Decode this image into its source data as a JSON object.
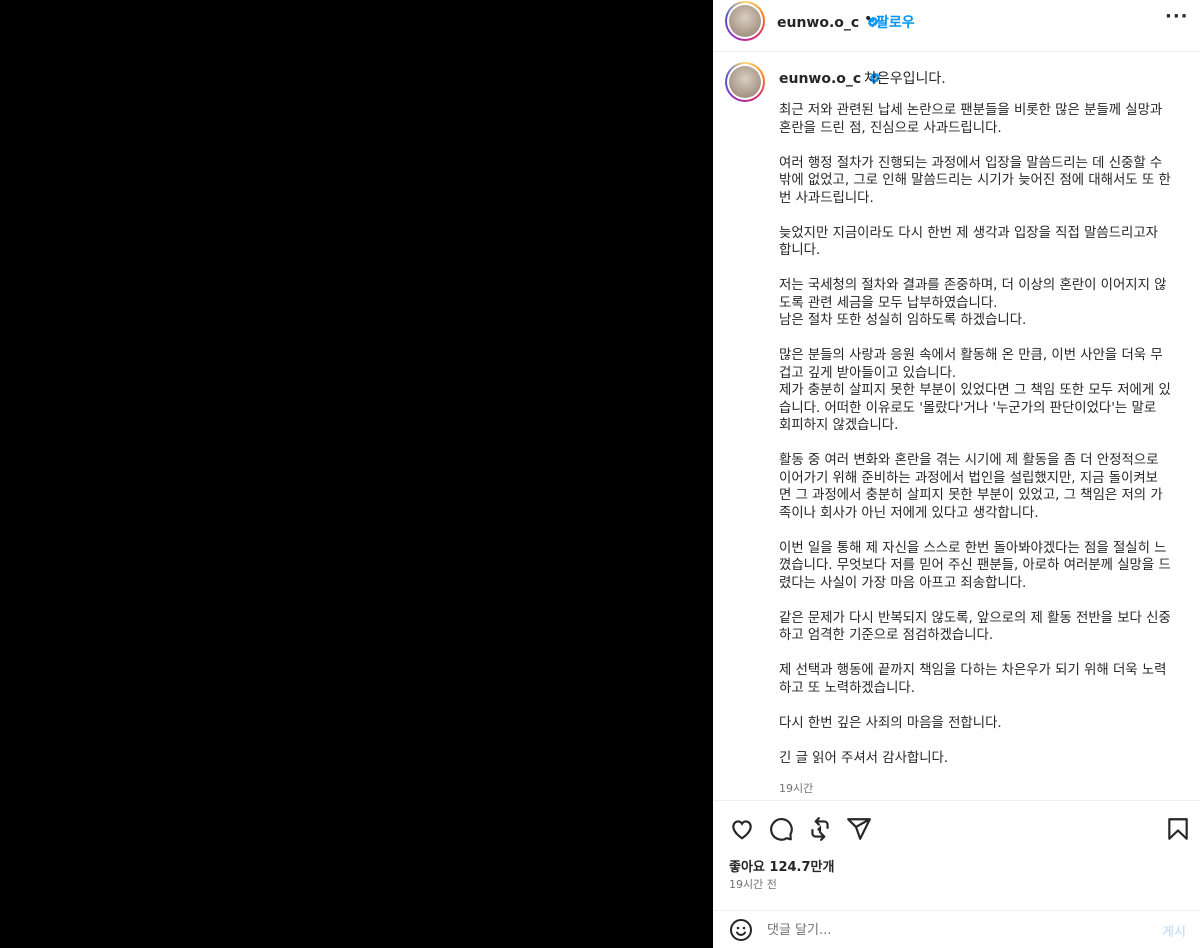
{
  "header": {
    "username": "eunwo.o_c",
    "dot": "•",
    "follow_label": "팔로우",
    "more_label": "···"
  },
  "caption": {
    "username": "eunwo.o_c",
    "first_line": "차은우입니다.",
    "text": "최근 저와 관련된 납세 논란으로 팬분들을 비롯한 많은 분들께 실망과\n혼란을 드린 점, 진심으로 사과드립니다.\n\n여러 행정 절차가 진행되는 과정에서 입장을 말씀드리는 데 신중할 수\n밖에 없었고, 그로 인해 말씀드리는 시기가 늦어진 점에 대해서도 또 한\n번 사과드립니다.\n\n늦었지만 지금이라도 다시 한번 제 생각과 입장을 직접 말씀드리고자\n합니다.\n\n저는 국세청의 절차와 결과를 존중하며, 더 이상의 혼란이 이어지지 않\n도록 관련 세금을 모두 납부하였습니다.\n남은 절차 또한 성실히 임하도록 하겠습니다.\n\n많은 분들의 사랑과 응원 속에서 활동해 온 만큼, 이번 사안을 더욱 무\n겁고 깊게 받아들이고 있습니다.\n제가 충분히 살피지 못한 부분이 있었다면 그 책임 또한 모두 저에게 있\n습니다. 어떠한 이유로도 '몰랐다'거나 '누군가의 판단이었다'는 말로\n회피하지 않겠습니다.\n\n활동 중 여러 변화와 혼란을 겪는 시기에 제 활동을 좀 더 안정적으로\n이어가기 위해 준비하는 과정에서 법인을 설립했지만, 지금 돌이켜보\n면 그 과정에서 충분히 살피지 못한 부분이 있었고, 그 책임은 저의 가\n족이나 회사가 아닌 저에게 있다고 생각합니다.\n\n이번 일을 통해 제 자신을 스스로 한번 돌아봐야겠다는 점을 절실히 느\n꼈습니다. 무엇보다 저를 믿어 주신 팬분들, 아로하 여러분께 실망을 드\n렸다는 사실이 가장 마음 아프고 죄송합니다.\n\n같은 문제가 다시 반복되지 않도록, 앞으로의 제 활동 전반을 보다 신중\n하고 엄격한 기준으로 점검하겠습니다.\n\n제 선택과 행동에 끝까지 책임을 다하는 차은우가 되기 위해 더욱 노력\n하고 또 노력하겠습니다.\n\n다시 한번 깊은 사죄의 마음을 전합니다.\n\n긴 글 읽어 주셔서 감사합니다.",
    "timestamp": "19시간"
  },
  "actions": {
    "likes": "좋아요 124.7만개",
    "post_time": "19시간 전"
  },
  "comment": {
    "placeholder": "댓글 달기...",
    "post_label": "게시"
  },
  "colors": {
    "accent": "#0095f6",
    "verified": "#0095f6",
    "post_disabled": "#b3dbff",
    "muted": "#737373"
  },
  "icons": [
    "verified-badge-icon",
    "more-options-icon",
    "heart-icon",
    "comment-icon",
    "repost-icon",
    "share-icon",
    "bookmark-icon",
    "emoji-icon"
  ]
}
